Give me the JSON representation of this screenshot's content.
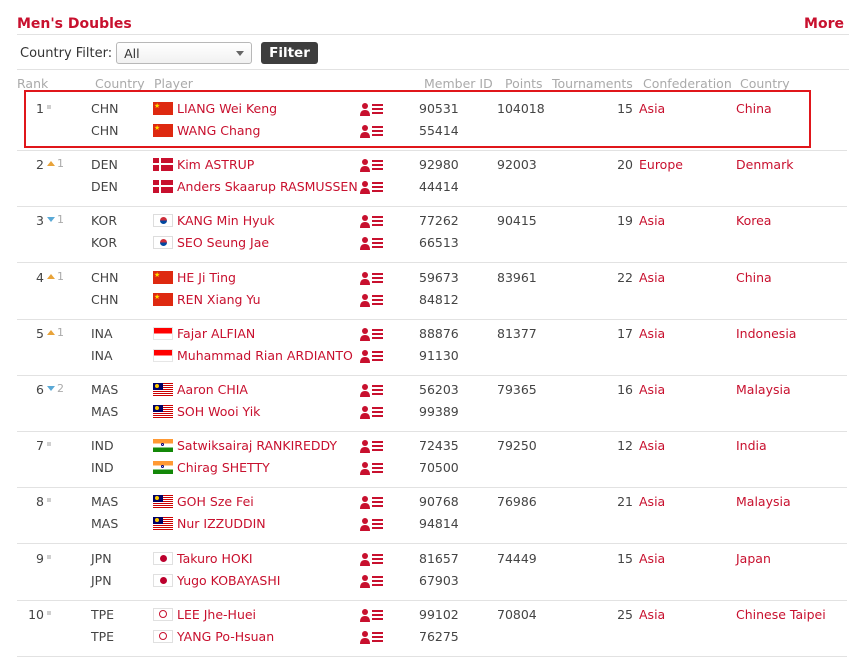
{
  "header": {
    "title": "Men's Doubles",
    "more": "More"
  },
  "filter": {
    "label": "Country Filter:",
    "selected": "All",
    "button": "Filter"
  },
  "columns": {
    "rank": "Rank",
    "country_code": "Country",
    "player": "Player",
    "member_id": "Member ID",
    "points": "Points",
    "tournaments": "Tournaments",
    "confederation": "Confederation",
    "country": "Country"
  },
  "icons": {
    "flag": "flag-icon",
    "profile": "player-profile-icon",
    "movement_up": "rank-up-icon",
    "movement_down": "rank-down-icon",
    "movement_same": "rank-unchanged-icon"
  },
  "colors": {
    "brand": "#c8102e",
    "highlight_box": "#e0161b",
    "rank_up": "#e8a33a",
    "rank_down": "#5aa9d6"
  },
  "rows": [
    {
      "rank": "1",
      "movement": "same",
      "movement_value": "",
      "code1": "CHN",
      "code2": "CHN",
      "flag": "chn",
      "player1": "LIANG Wei Keng",
      "player2": "WANG Chang",
      "id1": "90531",
      "id2": "55414",
      "points": "104018",
      "tournaments": "15",
      "confederation": "Asia",
      "country": "China"
    },
    {
      "rank": "2",
      "movement": "up",
      "movement_value": "1",
      "code1": "DEN",
      "code2": "DEN",
      "flag": "den",
      "player1": "Kim ASTRUP",
      "player2": "Anders Skaarup RASMUSSEN",
      "id1": "92980",
      "id2": "44414",
      "points": "92003",
      "tournaments": "20",
      "confederation": "Europe",
      "country": "Denmark"
    },
    {
      "rank": "3",
      "movement": "down",
      "movement_value": "1",
      "code1": "KOR",
      "code2": "KOR",
      "flag": "kor",
      "player1": "KANG Min Hyuk",
      "player2": "SEO Seung Jae",
      "id1": "77262",
      "id2": "66513",
      "points": "90415",
      "tournaments": "19",
      "confederation": "Asia",
      "country": "Korea"
    },
    {
      "rank": "4",
      "movement": "up",
      "movement_value": "1",
      "code1": "CHN",
      "code2": "CHN",
      "flag": "chn",
      "player1": "HE Ji Ting",
      "player2": "REN Xiang Yu",
      "id1": "59673",
      "id2": "84812",
      "points": "83961",
      "tournaments": "22",
      "confederation": "Asia",
      "country": "China"
    },
    {
      "rank": "5",
      "movement": "up",
      "movement_value": "1",
      "code1": "INA",
      "code2": "INA",
      "flag": "ina",
      "player1": "Fajar ALFIAN",
      "player2": "Muhammad Rian ARDIANTO",
      "id1": "88876",
      "id2": "91130",
      "points": "81377",
      "tournaments": "17",
      "confederation": "Asia",
      "country": "Indonesia"
    },
    {
      "rank": "6",
      "movement": "down",
      "movement_value": "2",
      "code1": "MAS",
      "code2": "MAS",
      "flag": "mas",
      "player1": "Aaron CHIA",
      "player2": "SOH Wooi Yik",
      "id1": "56203",
      "id2": "99389",
      "points": "79365",
      "tournaments": "16",
      "confederation": "Asia",
      "country": "Malaysia"
    },
    {
      "rank": "7",
      "movement": "same",
      "movement_value": "",
      "code1": "IND",
      "code2": "IND",
      "flag": "ind",
      "player1": "Satwiksairaj RANKIREDDY",
      "player2": "Chirag SHETTY",
      "id1": "72435",
      "id2": "70500",
      "points": "79250",
      "tournaments": "12",
      "confederation": "Asia",
      "country": "India"
    },
    {
      "rank": "8",
      "movement": "same",
      "movement_value": "",
      "code1": "MAS",
      "code2": "MAS",
      "flag": "mas",
      "player1": "GOH Sze Fei",
      "player2": "Nur IZZUDDIN",
      "id1": "90768",
      "id2": "94814",
      "points": "76986",
      "tournaments": "21",
      "confederation": "Asia",
      "country": "Malaysia"
    },
    {
      "rank": "9",
      "movement": "same",
      "movement_value": "",
      "code1": "JPN",
      "code2": "JPN",
      "flag": "jpn",
      "player1": "Takuro HOKI",
      "player2": "Yugo KOBAYASHI",
      "id1": "81657",
      "id2": "67903",
      "points": "74449",
      "tournaments": "15",
      "confederation": "Asia",
      "country": "Japan"
    },
    {
      "rank": "10",
      "movement": "same",
      "movement_value": "",
      "code1": "TPE",
      "code2": "TPE",
      "flag": "tpe",
      "player1": "LEE Jhe-Huei",
      "player2": "YANG Po-Hsuan",
      "id1": "99102",
      "id2": "76275",
      "points": "70804",
      "tournaments": "25",
      "confederation": "Asia",
      "country": "Chinese Taipei"
    }
  ]
}
